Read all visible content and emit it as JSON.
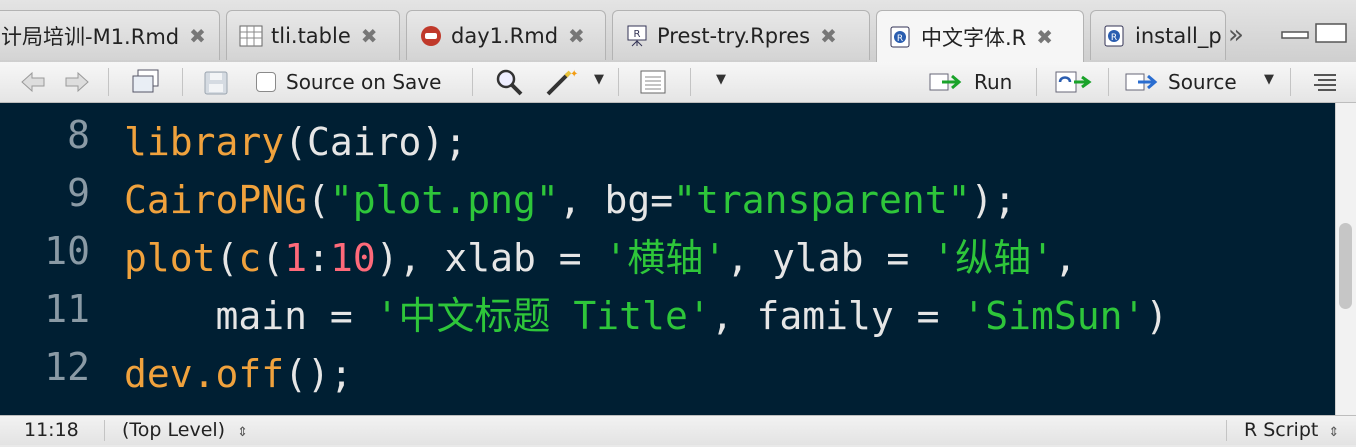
{
  "tabs": [
    {
      "label": "计局培训-M1.Rmd",
      "icon": "rmd-icon"
    },
    {
      "label": "tli.table",
      "icon": "table-icon"
    },
    {
      "label": "day1.Rmd",
      "icon": "rmd-icon"
    },
    {
      "label": "Prest-try.Rpres",
      "icon": "rpres-icon"
    },
    {
      "label": "中文字体.R",
      "icon": "rscript-icon",
      "active": true
    },
    {
      "label": "install_p",
      "icon": "rscript-icon"
    }
  ],
  "toolbar": {
    "source_on_save": "Source on Save",
    "run": "Run",
    "source": "Source"
  },
  "editor": {
    "line_numbers": [
      "8",
      "9",
      "10",
      "11",
      "12"
    ],
    "lines": [
      [
        {
          "t": "library",
          "c": "fn"
        },
        {
          "t": "(Cairo);",
          "c": "op"
        }
      ],
      [
        {
          "t": "CairoPNG",
          "c": "fn"
        },
        {
          "t": "(",
          "c": "op"
        },
        {
          "t": "\"plot.png\"",
          "c": "str"
        },
        {
          "t": ", bg=",
          "c": "op"
        },
        {
          "t": "\"transparent\"",
          "c": "str"
        },
        {
          "t": ");",
          "c": "op"
        }
      ],
      [
        {
          "t": "plot",
          "c": "fn"
        },
        {
          "t": "(",
          "c": "op"
        },
        {
          "t": "c",
          "c": "fn"
        },
        {
          "t": "(",
          "c": "op"
        },
        {
          "t": "1",
          "c": "num"
        },
        {
          "t": ":",
          "c": "op"
        },
        {
          "t": "10",
          "c": "num"
        },
        {
          "t": "), xlab = ",
          "c": "op"
        },
        {
          "t": "'横轴'",
          "c": "str"
        },
        {
          "t": ", ylab = ",
          "c": "op"
        },
        {
          "t": "'纵轴'",
          "c": "str"
        },
        {
          "t": ",",
          "c": "op"
        }
      ],
      [
        {
          "t": "    main = ",
          "c": "op"
        },
        {
          "t": "'中文标题 Title'",
          "c": "str"
        },
        {
          "t": ", family = ",
          "c": "op"
        },
        {
          "t": "'SimSun'",
          "c": "str"
        },
        {
          "t": ")",
          "c": "op"
        }
      ],
      [
        {
          "t": "dev.off",
          "c": "fn"
        },
        {
          "t": "();",
          "c": "op"
        }
      ]
    ]
  },
  "status": {
    "position": "11:18",
    "scope": "(Top Level)",
    "file_type": "R Script"
  },
  "colors": {
    "editor_bg": "#001f33",
    "function": "#f0a23d",
    "string": "#2ec63a",
    "number": "#ff6a7a"
  }
}
